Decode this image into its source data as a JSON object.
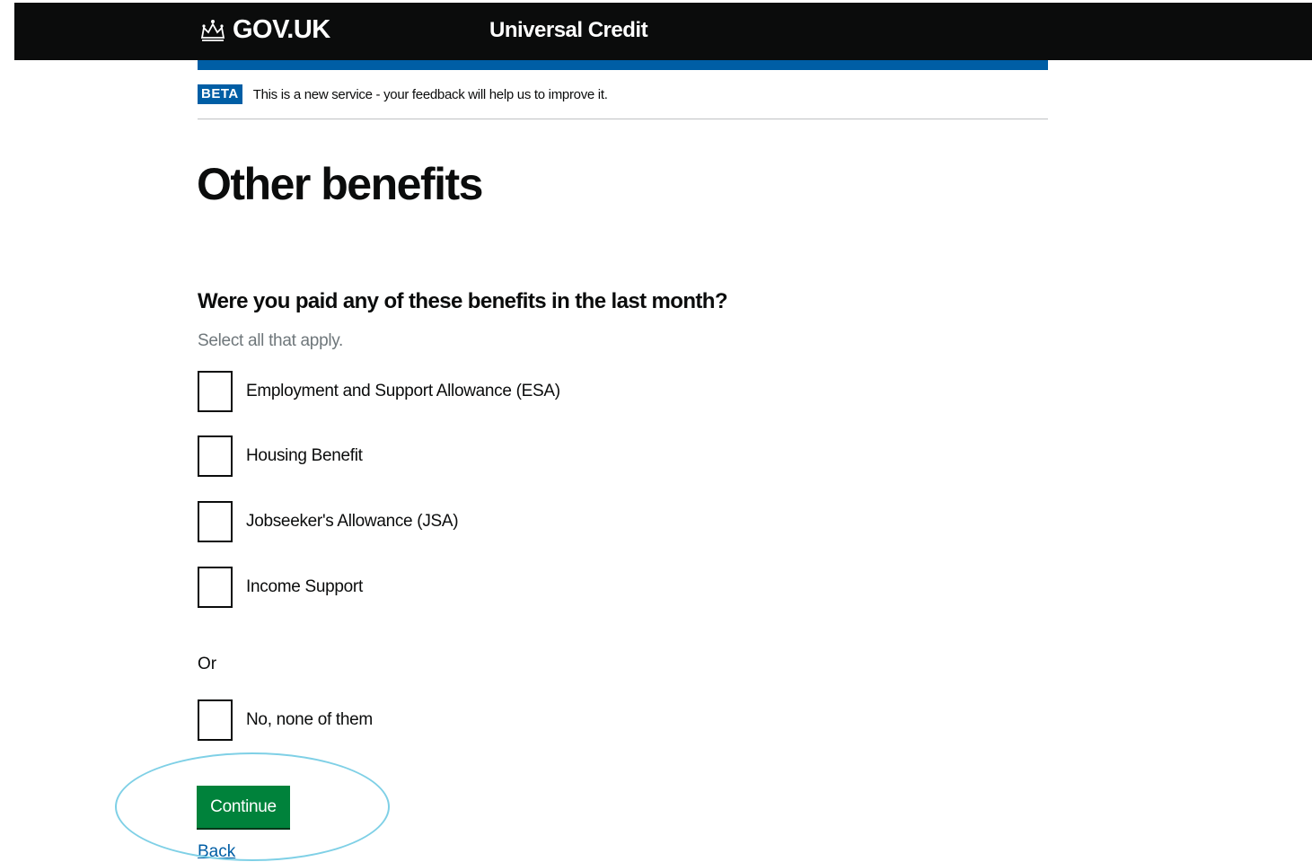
{
  "header": {
    "logo_text": "GOV.UK",
    "service_name": "Universal Credit"
  },
  "phase_banner": {
    "tag": "BETA",
    "text": "This is a new service - your feedback will help us to improve it."
  },
  "page": {
    "title": "Other benefits",
    "question": "Were you paid any of these benefits in the last month?",
    "hint": "Select all that apply.",
    "options": [
      {
        "label": "Employment and Support Allowance (ESA)",
        "checked": false
      },
      {
        "label": "Housing Benefit",
        "checked": false
      },
      {
        "label": "Jobseeker's Allowance (JSA)",
        "checked": false
      },
      {
        "label": "Income Support",
        "checked": false
      }
    ],
    "or_text": "Or",
    "none_option": {
      "label": "No, none of them",
      "checked": false
    },
    "continue_label": "Continue",
    "back_label": "Back"
  },
  "colors": {
    "header_bg": "#0b0c0c",
    "brand_blue": "#005ea5",
    "button_green": "#00823b",
    "highlight": "#7fd0e6"
  },
  "icons": {
    "logo": "crown-icon"
  }
}
